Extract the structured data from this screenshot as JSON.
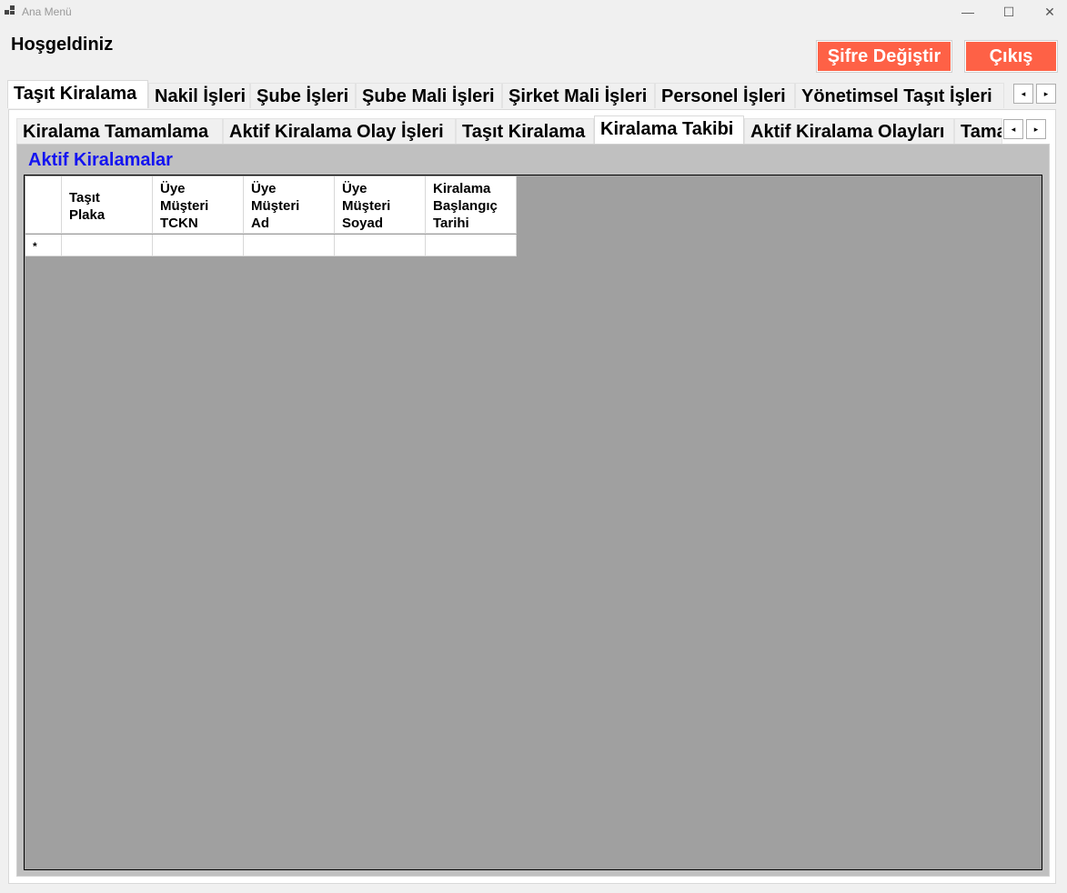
{
  "window": {
    "title": "Ana Menü",
    "minimize": "—",
    "maximize": "☐",
    "close": "✕"
  },
  "header": {
    "greeting": "Hoşgeldiniz",
    "change_password": "Şifre Değiştir",
    "exit": "Çıkış"
  },
  "main_tabs": [
    "Taşıt Kiralama",
    "Nakil İşleri",
    "Şube İşleri",
    "Şube Mali İşleri",
    "Şirket Mali İşleri",
    "Personel İşleri",
    "Yönetimsel Taşıt İşleri"
  ],
  "sub_tabs": [
    "Kiralama Tamamlama",
    "Aktif Kiralama Olay İşleri",
    "Taşıt Kiralama",
    "Kiralama Takibi",
    "Aktif Kiralama Olayları",
    "Tama"
  ],
  "scroll": {
    "left": "◂",
    "right": "▸"
  },
  "section": {
    "title": "Aktif Kiralamalar"
  },
  "grid": {
    "columns": [
      [
        "Taşıt",
        "Plaka"
      ],
      [
        "Üye",
        "Müşteri",
        "TCKN"
      ],
      [
        "Üye",
        "Müşteri",
        "Ad"
      ],
      [
        "Üye",
        "Müşteri",
        "Soyad"
      ],
      [
        "Kiralama",
        "Başlangıç",
        "Tarihi"
      ]
    ],
    "new_row_marker": "*"
  },
  "colors": {
    "accent_button": "#fe6146",
    "section_title": "#1414f0",
    "grid_bg": "#a0a0a0"
  }
}
